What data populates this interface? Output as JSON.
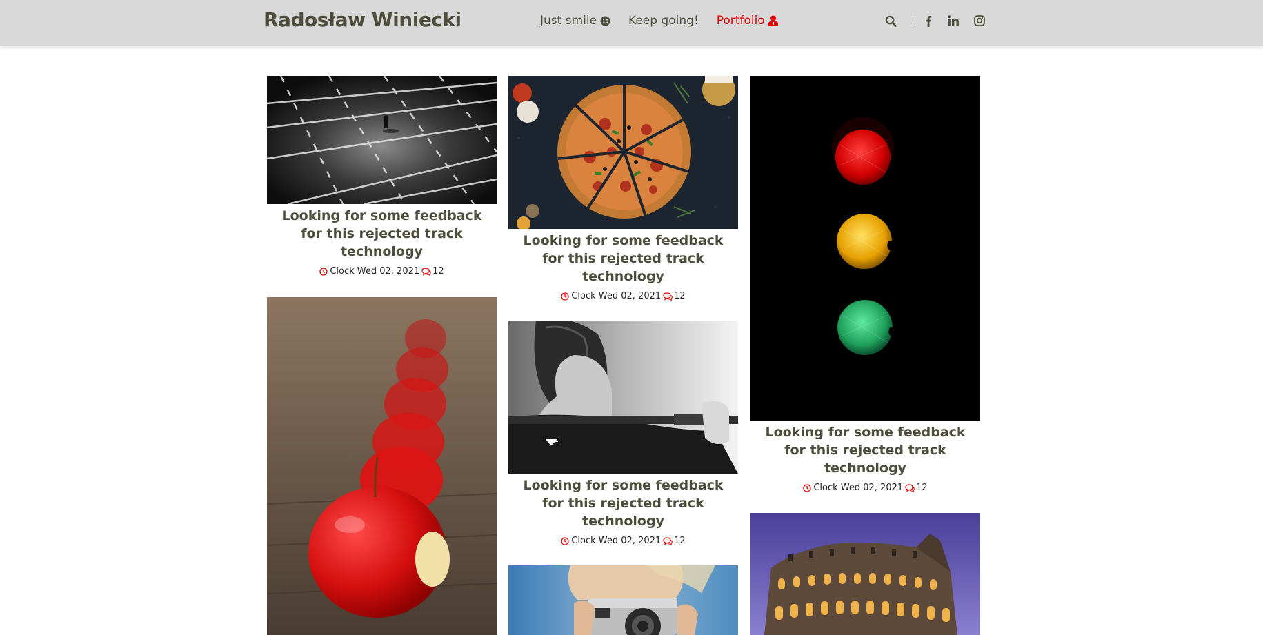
{
  "header": {
    "brand": "Radosław Winiecki",
    "nav": [
      {
        "label": "Just smile",
        "icon": "smile-icon"
      },
      {
        "label": "Keep going!",
        "icon": ""
      },
      {
        "label": "Portfolio",
        "icon": "user-icon",
        "active": true
      }
    ],
    "tools": [
      "search-icon",
      "facebook-icon",
      "linkedin-icon",
      "instagram-icon"
    ]
  },
  "colors": {
    "accent": "#e60000",
    "header_bg": "#d9d9d9",
    "text": "#4d4d3b"
  },
  "posts": [
    {
      "title": "Looking for some feedback for this rejected track technology",
      "date": "Clock Wed 02, 2021",
      "comments": "12",
      "image": "parking-lot-photo"
    },
    {
      "title": "Looking for some feedback for this rejected track technology",
      "date": "Clock Wed 02, 2021",
      "comments": "12",
      "image": "pizza-photo"
    },
    {
      "title": "Looking for some feedback for this rejected track technology",
      "date": "Clock Wed 02, 2021",
      "comments": "12",
      "image": "traffic-light-photo"
    },
    {
      "title": "",
      "date": "",
      "comments": "",
      "image": "apples-photo"
    },
    {
      "title": "Looking for some feedback for this rejected track technology",
      "date": "Clock Wed 02, 2021",
      "comments": "12",
      "image": "weightlifting-photo"
    },
    {
      "title": "",
      "date": "",
      "comments": "",
      "image": "camera-photo"
    },
    {
      "title": "",
      "date": "",
      "comments": "",
      "image": "colosseum-photo"
    }
  ]
}
